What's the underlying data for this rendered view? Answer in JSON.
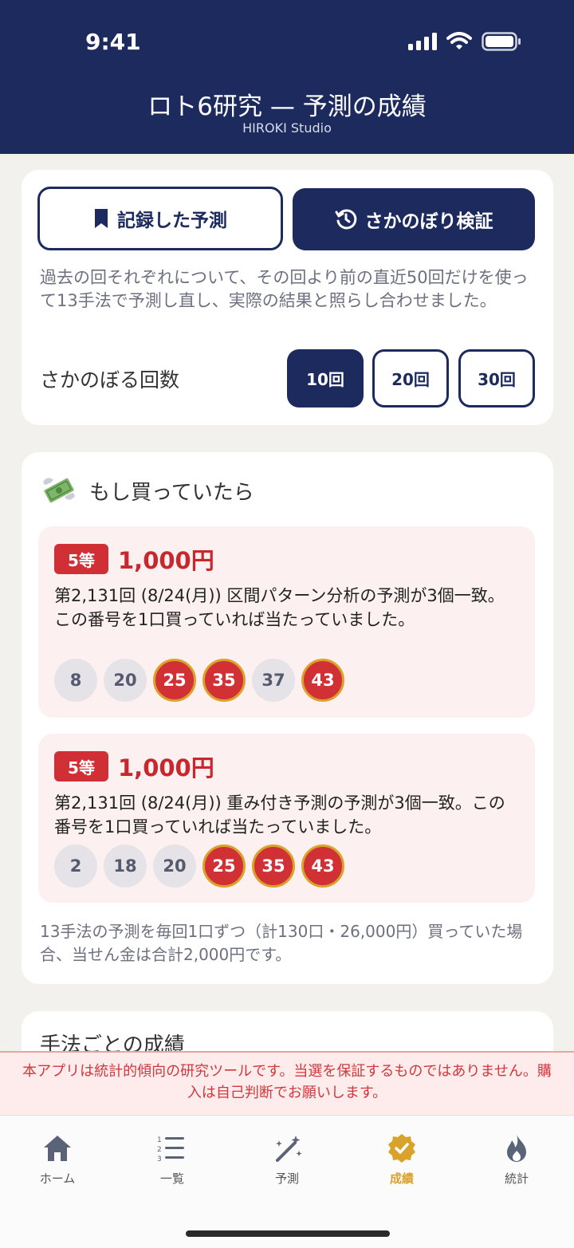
{
  "status": {
    "time": "9:41"
  },
  "header": {
    "title": "ロト6研究 — 予測の成績",
    "subtitle": "HIROKI Studio"
  },
  "mode": {
    "recorded_label": "記録した予測",
    "retro_label": "さかのぼり検証",
    "description": "過去の回それぞれについて、その回より前の直近50回だけを使って13手法で予測し直し、実際の結果と照らし合わせました。",
    "count_label": "さかのぼる回数",
    "count_options": [
      "10回",
      "20回",
      "30回"
    ],
    "selected_count": "10回"
  },
  "if_bought": {
    "title": "もし買っていたら",
    "wins": [
      {
        "prize": "5等",
        "amount": "1,000円",
        "text": "第2,131回 (8/24(月)) 区間パターン分析の予測が3個一致。この番号を1口買っていれば当たっていました。",
        "numbers": [
          "8",
          "20",
          "25",
          "35",
          "37",
          "43"
        ],
        "hits": [
          "25",
          "35",
          "43"
        ]
      },
      {
        "prize": "5等",
        "amount": "1,000円",
        "text": "第2,131回 (8/24(月)) 重み付き予測の予測が3個一致。この番号を1口買っていれば当たっていました。",
        "numbers": [
          "2",
          "18",
          "20",
          "25",
          "35",
          "43"
        ],
        "hits": [
          "25",
          "35",
          "43"
        ]
      }
    ],
    "summary": "13手法の予測を毎回1口ずつ（計130口・26,000円）買っていた場合、当せん金は合計2,000円です。"
  },
  "methods": {
    "title": "手法ごとの成績"
  },
  "disclaimer": "本アプリは統計的傾向の研究ツールです。当選を保証するものではありません。購入は自己判断でお願いします。",
  "tabs": [
    {
      "label": "ホーム",
      "icon": "house-icon"
    },
    {
      "label": "一覧",
      "icon": "list-icon"
    },
    {
      "label": "予測",
      "icon": "magic-wand-icon"
    },
    {
      "label": "成績",
      "icon": "badge-check-icon",
      "active": true
    },
    {
      "label": "統計",
      "icon": "flame-icon"
    }
  ],
  "colors": {
    "navy": "#1c2a5e",
    "red": "#cf2f35",
    "gold": "#d9a22a"
  }
}
